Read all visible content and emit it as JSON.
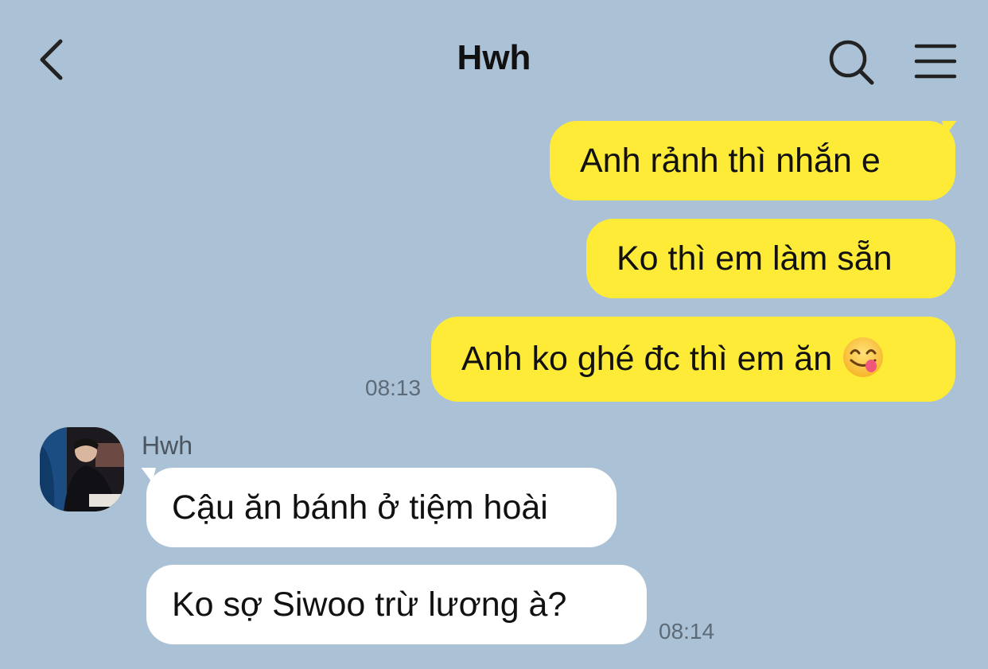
{
  "header": {
    "title": "Hwh",
    "back_icon": "chevron-left-icon",
    "search_icon": "search-icon",
    "menu_icon": "hamburger-menu-icon"
  },
  "colors": {
    "background": "#abc1d6",
    "outgoing_bubble": "#feeb37",
    "incoming_bubble": "#ffffff"
  },
  "messages": [
    {
      "direction": "outgoing",
      "text": "Anh rảnh thì nhắn e"
    },
    {
      "direction": "outgoing",
      "text": "Ko thì em làm sẵn"
    },
    {
      "direction": "outgoing",
      "text": "Anh ko ghé đc thì em ăn",
      "emoji": "face-savoring-food-emoji",
      "time": "08:13"
    },
    {
      "direction": "incoming",
      "sender": "Hwh",
      "text": "Cậu ăn bánh ở tiệm hoài"
    },
    {
      "direction": "incoming",
      "text": "Ko sợ Siwoo trừ lương à?",
      "time": "08:14"
    }
  ]
}
